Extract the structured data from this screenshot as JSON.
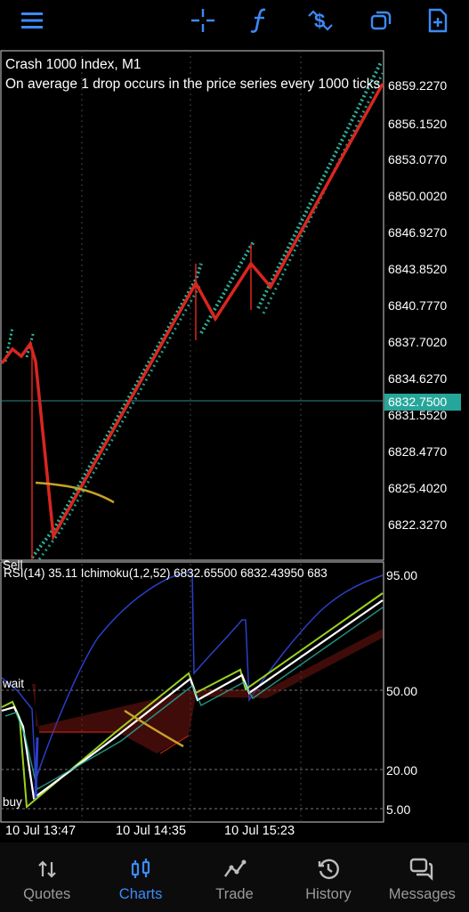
{
  "toolbar": {
    "icons": [
      "menu-icon",
      "crosshair-icon",
      "function-icon",
      "dollar-arrows-icon",
      "windows-icon",
      "add-file-icon"
    ],
    "accent": "#3d8af7"
  },
  "chart": {
    "symbol_title": "Crash 1000 Index, M1",
    "description": "On average 1 drop occurs in the price series every 1000 ticks",
    "current_price": "6832.7500",
    "price_axis": [
      "6859.2270",
      "6856.1520",
      "6853.0770",
      "6850.0020",
      "6846.9270",
      "6843.8520",
      "6840.7770",
      "6837.7020",
      "6834.6270",
      "6831.5520",
      "6828.4770",
      "6825.4020",
      "6822.3270"
    ],
    "sell_label": "Sell",
    "colors": {
      "bull": "#26a69a",
      "bear": "#e02c28",
      "ma": "#c9a227",
      "grid": "#555555"
    }
  },
  "indicator": {
    "title": "RSI(14) 35.11 Ichimoku(1,2,52) 6832.65500 6832.43950 683",
    "levels": [
      "95.00",
      "50.00",
      "20.00",
      "5.00"
    ],
    "wait_label": "wait",
    "buy_label": "buy"
  },
  "time_axis": [
    "10 Jul 13:47",
    "10 Jul 14:35",
    "10 Jul 15:23"
  ],
  "nav": {
    "items": [
      {
        "label": "Quotes",
        "icon": "quotes-arrows-icon",
        "active": false
      },
      {
        "label": "Charts",
        "icon": "candles-icon",
        "active": true
      },
      {
        "label": "Trade",
        "icon": "trade-line-icon",
        "active": false
      },
      {
        "label": "History",
        "icon": "history-clock-icon",
        "active": false
      },
      {
        "label": "Messages",
        "icon": "messages-icon",
        "active": false
      }
    ]
  }
}
